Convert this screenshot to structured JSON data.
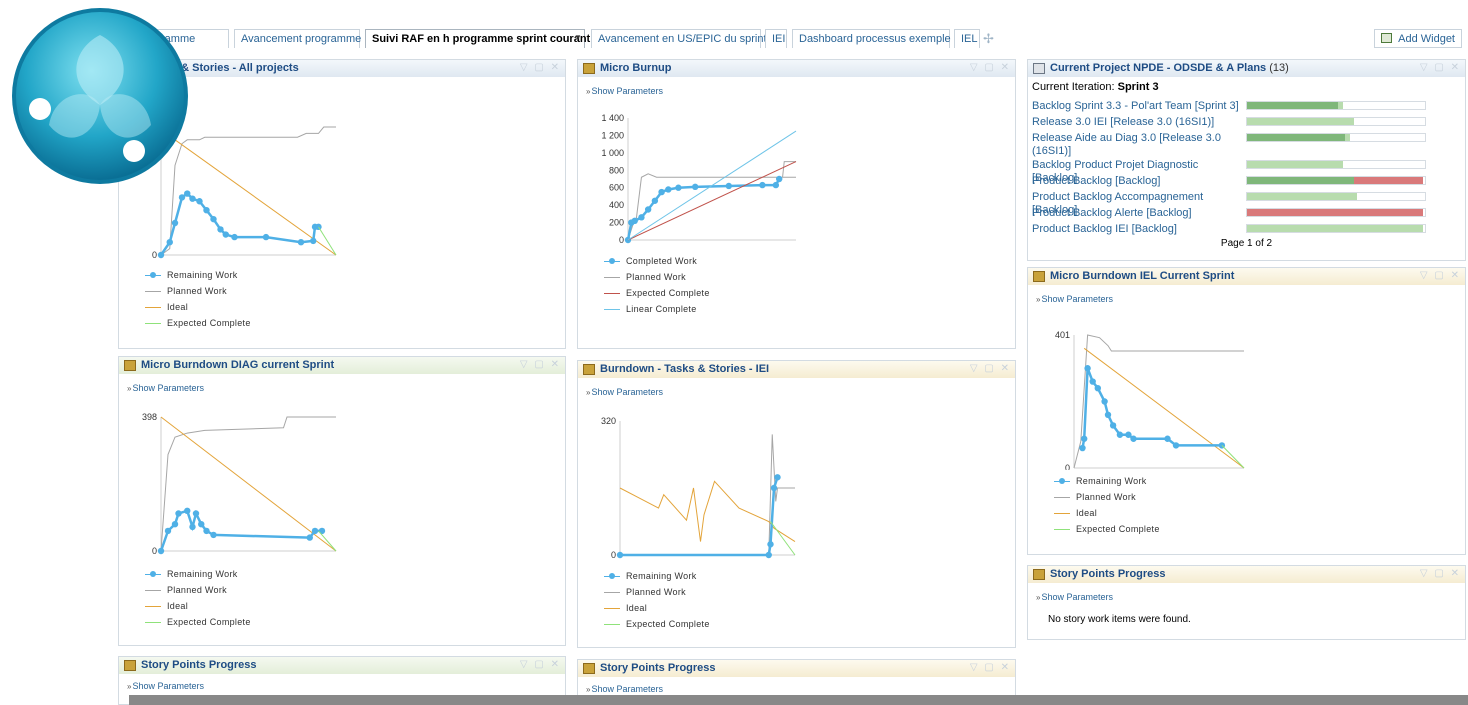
{
  "tabs": [
    {
      "label": "Av"
    },
    {
      "label": "programme"
    },
    {
      "label": "Avancement programme"
    },
    {
      "label": "Suivi RAF en h programme sprint courant",
      "active": true
    },
    {
      "label": "Avancement en US/EPIC du sprint"
    },
    {
      "label": "IEI"
    },
    {
      "label": "Dashboard processus exemple"
    },
    {
      "label": "IEL"
    }
  ],
  "add_widget_label": "Add Widget",
  "show_params": "Show Parameters",
  "legend_labels": {
    "remaining": "Remaining Work",
    "planned": "Planned Work",
    "ideal": "Ideal",
    "expected": "Expected Complete",
    "completed": "Completed Work",
    "linear": "Linear Complete"
  },
  "colors": {
    "remaining": "#4fb0e6",
    "planned": "#a6a6a6",
    "ideal": "#e3a43a",
    "expected": "#8fe27a",
    "expected_burnup": "#c0524b",
    "linear": "#6ec4e8"
  },
  "widgets": {
    "w1": {
      "title": "- Tasks & Stories - All projects",
      "show_params": "ters"
    },
    "w2": {
      "title": "Micro Burnup"
    },
    "w3": {
      "title": "Micro Burndown DIAG current Sprint"
    },
    "w4": {
      "title": "Burndown - Tasks & Stories - IEI"
    },
    "w5": {
      "title": "Story Points Progress"
    },
    "w6": {
      "title": "Story Points Progress"
    },
    "project": {
      "title": "Current Project NPDE - ODSDE & A Plans",
      "count": "(13)",
      "iteration_label": "Current Iteration:",
      "iteration_value": "Sprint 3",
      "pager": "Page 1 of 2",
      "rows": [
        {
          "label": "Backlog Sprint 3.3 - Pol'art Team [Sprint 3]",
          "done": 0.51,
          "inprog": 0.03,
          "blocked": 0
        },
        {
          "label": "Release 3.0 IEI [Release 3.0 (16SI1)]",
          "done": 0.0,
          "inprog": 0.6,
          "blocked": 0
        },
        {
          "label": "Release Aide au Diag 3.0 [Release 3.0 (16SI1)]",
          "done": 0.55,
          "inprog": 0.03,
          "blocked": 0
        },
        {
          "label": "Backlog Product Projet Diagnostic [Backlog]",
          "done": 0.0,
          "inprog": 0.54,
          "blocked": 0
        },
        {
          "label": "Product Backlog [Backlog]",
          "done": 0.6,
          "inprog": 0.0,
          "blocked": 0.39
        },
        {
          "label": "Product Backlog Accompagnement [Backlog]",
          "done": 0.0,
          "inprog": 0.62,
          "blocked": 0
        },
        {
          "label": "Product Backlog Alerte [Backlog]",
          "done": 0.0,
          "inprog": 0.0,
          "blocked": 0.99
        },
        {
          "label": "Product Backlog IEI [Backlog]",
          "done": 0.0,
          "inprog": 0.99,
          "blocked": 0
        }
      ]
    },
    "iel": {
      "title": "Micro Burndown IEL Current Sprint"
    },
    "sp3": {
      "title": "Story Points Progress",
      "message": "No story work items were found."
    }
  },
  "chart_data": [
    {
      "type": "line",
      "ymax_label": "",
      "ticks": [
        "0"
      ],
      "series": [
        {
          "key": "planned",
          "points": [
            [
              0,
              0
            ],
            [
              5,
              0.05
            ],
            [
              8,
              0.7
            ],
            [
              12,
              0.87
            ],
            [
              15,
              0.9
            ],
            [
              22,
              0.9
            ],
            [
              25,
              0.92
            ],
            [
              78,
              0.92
            ],
            [
              83,
              0.95
            ],
            [
              90,
              0.95
            ],
            [
              93,
              1.0
            ],
            [
              100,
              1.0
            ]
          ]
        },
        {
          "key": "ideal",
          "points": [
            [
              8,
              0.9
            ],
            [
              100,
              0
            ]
          ]
        },
        {
          "key": "remaining",
          "points": [
            [
              0,
              0
            ],
            [
              5,
              0.1
            ],
            [
              8,
              0.25
            ],
            [
              12,
              0.45
            ],
            [
              15,
              0.48
            ],
            [
              18,
              0.44
            ],
            [
              22,
              0.42
            ],
            [
              26,
              0.35
            ],
            [
              30,
              0.28
            ],
            [
              34,
              0.2
            ],
            [
              37,
              0.16
            ],
            [
              42,
              0.14
            ],
            [
              60,
              0.14
            ],
            [
              80,
              0.1
            ],
            [
              87,
              0.11
            ],
            [
              88,
              0.22
            ],
            [
              90,
              0.22
            ]
          ]
        },
        {
          "key": "expected",
          "points": [
            [
              90,
              0.22
            ],
            [
              100,
              0
            ]
          ]
        }
      ]
    },
    {
      "type": "line",
      "ticks": [
        "0",
        "200",
        "400",
        "600",
        "800",
        "1 000",
        "1 200",
        "1 400"
      ],
      "ymax": 1400,
      "series": [
        {
          "key": "planned",
          "points": [
            [
              0,
              0
            ],
            [
              3,
              180
            ],
            [
              5,
              250
            ],
            [
              8,
              720
            ],
            [
              12,
              760
            ],
            [
              17,
              720
            ],
            [
              100,
              720
            ],
            [
              92,
              720
            ],
            [
              93,
              900
            ],
            [
              100,
              900
            ]
          ]
        },
        {
          "key": "remaining",
          "points": [
            [
              0,
              0
            ],
            [
              2,
              200
            ],
            [
              4,
              220
            ],
            [
              8,
              260
            ],
            [
              12,
              350
            ],
            [
              16,
              450
            ],
            [
              20,
              550
            ],
            [
              24,
              580
            ],
            [
              30,
              600
            ],
            [
              40,
              610
            ],
            [
              60,
              620
            ],
            [
              80,
              630
            ],
            [
              88,
              630
            ],
            [
              90,
              700
            ]
          ]
        },
        {
          "key": "expected_burnup",
          "points": [
            [
              0,
              0
            ],
            [
              100,
              900
            ]
          ]
        },
        {
          "key": "linear",
          "points": [
            [
              0,
              0
            ],
            [
              100,
              1250
            ]
          ]
        }
      ]
    },
    {
      "type": "line",
      "ticks": [
        "0",
        "398"
      ],
      "series": [
        {
          "key": "planned",
          "points": [
            [
              0,
              0
            ],
            [
              4,
              0.72
            ],
            [
              8,
              0.85
            ],
            [
              15,
              0.88
            ],
            [
              25,
              0.9
            ],
            [
              70,
              0.92
            ],
            [
              72,
              1.0
            ],
            [
              100,
              1.0
            ]
          ]
        },
        {
          "key": "ideal",
          "points": [
            [
              0,
              1.0
            ],
            [
              100,
              0
            ]
          ]
        },
        {
          "key": "remaining",
          "points": [
            [
              0,
              0
            ],
            [
              4,
              0.15
            ],
            [
              8,
              0.2
            ],
            [
              10,
              0.28
            ],
            [
              15,
              0.3
            ],
            [
              18,
              0.18
            ],
            [
              20,
              0.28
            ],
            [
              23,
              0.2
            ],
            [
              26,
              0.15
            ],
            [
              30,
              0.12
            ],
            [
              85,
              0.1
            ],
            [
              88,
              0.15
            ],
            [
              92,
              0.15
            ]
          ]
        },
        {
          "key": "expected",
          "points": [
            [
              90,
              0.15
            ],
            [
              100,
              0
            ]
          ]
        }
      ]
    },
    {
      "type": "line",
      "ticks": [
        "0",
        "320"
      ],
      "series": [
        {
          "key": "planned",
          "points": [
            [
              0,
              0
            ],
            [
              85,
              0
            ],
            [
              87,
              0.9
            ],
            [
              89,
              0.4
            ],
            [
              90,
              0.5
            ],
            [
              100,
              0.5
            ]
          ]
        },
        {
          "key": "ideal",
          "points": [
            [
              0,
              0.5
            ],
            [
              22,
              0.35
            ],
            [
              25,
              0.45
            ],
            [
              38,
              0.26
            ],
            [
              42,
              0.5
            ],
            [
              46,
              0.1
            ],
            [
              48,
              0.3
            ],
            [
              54,
              0.55
            ],
            [
              68,
              0.35
            ],
            [
              85,
              0.25
            ],
            [
              88,
              0.2
            ],
            [
              100,
              0.1
            ]
          ]
        },
        {
          "key": "remaining",
          "points": [
            [
              0,
              0
            ],
            [
              85,
              0
            ],
            [
              86,
              0.08
            ],
            [
              88,
              0.5
            ],
            [
              90,
              0.58
            ]
          ]
        },
        {
          "key": "expected",
          "points": [
            [
              86,
              0.25
            ],
            [
              100,
              0
            ]
          ]
        }
      ]
    },
    {
      "type": "line",
      "ticks": [
        "0",
        "401"
      ],
      "series": [
        {
          "key": "planned",
          "points": [
            [
              0,
              0
            ],
            [
              4,
              0.2
            ],
            [
              8,
              1.0
            ],
            [
              15,
              0.98
            ],
            [
              20,
              0.92
            ],
            [
              22,
              0.88
            ],
            [
              100,
              0.88
            ]
          ]
        },
        {
          "key": "ideal",
          "points": [
            [
              6,
              0.9
            ],
            [
              100,
              0
            ]
          ]
        },
        {
          "key": "remaining",
          "points": [
            [
              5,
              0.15
            ],
            [
              6,
              0.22
            ],
            [
              8,
              0.75
            ],
            [
              11,
              0.65
            ],
            [
              14,
              0.6
            ],
            [
              18,
              0.5
            ],
            [
              20,
              0.4
            ],
            [
              23,
              0.32
            ],
            [
              27,
              0.25
            ],
            [
              32,
              0.25
            ],
            [
              35,
              0.22
            ],
            [
              55,
              0.22
            ],
            [
              60,
              0.17
            ],
            [
              87,
              0.17
            ]
          ]
        },
        {
          "key": "expected",
          "points": [
            [
              87,
              0.17
            ],
            [
              100,
              0
            ]
          ]
        }
      ]
    }
  ]
}
